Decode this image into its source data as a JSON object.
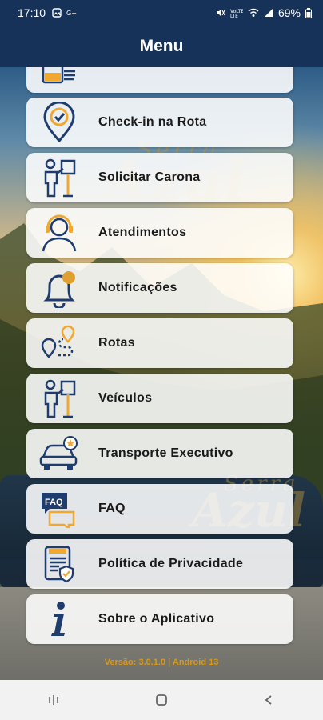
{
  "status_bar": {
    "time": "17:10",
    "battery": "69%",
    "left_icons": [
      "gallery-icon",
      "signal-icon"
    ],
    "right_icons": [
      "mute-icon",
      "volte-icon",
      "wifi-icon",
      "signal-bars-icon",
      "battery-icon"
    ]
  },
  "app_bar": {
    "title": "Menu"
  },
  "menu": {
    "items": [
      {
        "label": "",
        "icon": "ticket-icon"
      },
      {
        "label": "Check-in na Rota",
        "icon": "location-check-icon"
      },
      {
        "label": "Solicitar Carona",
        "icon": "person-sign-icon"
      },
      {
        "label": "Atendimentos",
        "icon": "support-agent-icon"
      },
      {
        "label": "Notificações",
        "icon": "bell-icon"
      },
      {
        "label": "Rotas",
        "icon": "route-icon"
      },
      {
        "label": "Veículos",
        "icon": "person-sign-icon"
      },
      {
        "label": "Transporte Executivo",
        "icon": "car-star-icon"
      },
      {
        "label": "FAQ",
        "icon": "faq-icon"
      },
      {
        "label": "Política de Privacidade",
        "icon": "privacy-document-icon"
      },
      {
        "label": "Sobre o Aplicativo",
        "icon": "info-icon"
      }
    ]
  },
  "watermark": {
    "brand_top": "Serra",
    "brand_main": "Azul"
  },
  "footer": {
    "version": "Versão: 3.0.1.0 | Android 13"
  },
  "nav_bar": {
    "icons": [
      "recent-apps-icon",
      "home-icon",
      "back-icon"
    ]
  },
  "colors": {
    "header": "#163258",
    "accent": "#f0a830",
    "icon_blue": "#1f3c6e"
  }
}
